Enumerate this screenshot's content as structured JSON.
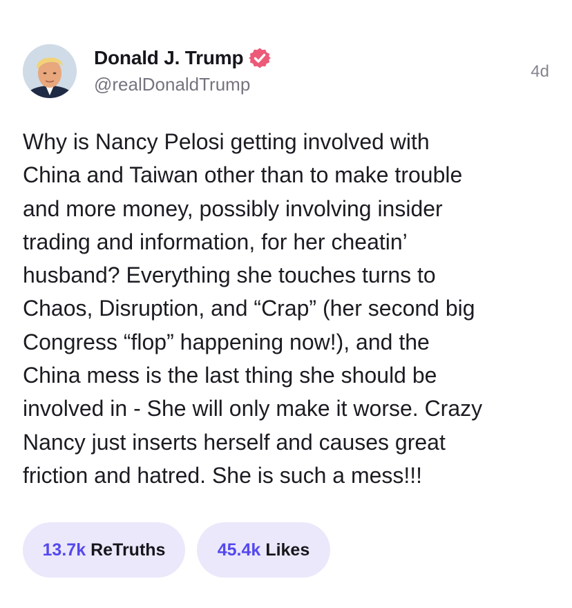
{
  "author": {
    "display_name": "Donald J. Trump",
    "handle": "@realDonaldTrump",
    "verified_icon": "verified-badge-icon",
    "verified_color": "#ec5a78"
  },
  "timestamp": "4d",
  "post_text": "Why is Nancy Pelosi getting involved with\nChina and Taiwan other than to make trouble\nand more money, possibly involving insider\ntrading and information, for her cheatin’\nhusband? Everything she touches turns to\nChaos, Disruption, and “Crap” (her second big\nCongress “flop” happening now!), and the\nChina mess is the last thing she should be\ninvolved in - She will only make it worse. Crazy\nNancy just inserts herself and causes great\nfriction and hatred. She is such a mess!!!",
  "stats": {
    "retruths_count": "13.7k",
    "retruths_label": "ReTruths",
    "likes_count": "45.4k",
    "likes_label": "Likes"
  },
  "colors": {
    "accent": "#5448ee",
    "pill_bg": "#ebe8fb",
    "text": "#1c1b22",
    "muted": "#76737f"
  }
}
